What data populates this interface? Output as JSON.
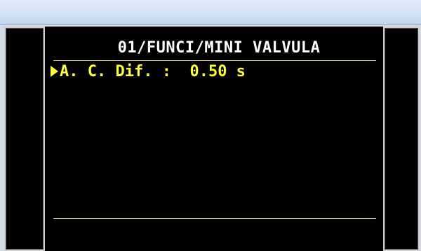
{
  "screen": {
    "title": "01/FUNCI/MINI VALVULA",
    "items": [
      {
        "label": "A. C. Dif. :",
        "value": "0.50 s",
        "selected": true
      }
    ]
  },
  "colors": {
    "lcd_background": "#000000",
    "title_text": "#ffffff",
    "item_text": "#ffff40",
    "divider": "#c9c94a",
    "window_bar": "#d2e1f5"
  },
  "icons": {
    "cursor": "triangle-right-cursor-icon"
  }
}
